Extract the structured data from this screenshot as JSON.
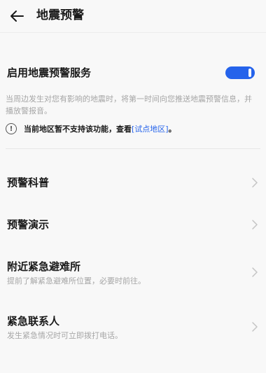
{
  "header": {
    "title": "地震预警",
    "back_icon": "arrow-left-icon"
  },
  "service": {
    "label": "启用地震预警服务",
    "enabled": true,
    "accent_color": "#2563eb"
  },
  "description": "当周边发生对您有影响的地震时，将第一时间向您推送地震预警信息，并播放警报音。",
  "notice": {
    "icon": "info-icon",
    "icon_glyph": "!",
    "text": "当前地区暂不支持该功能，查看",
    "link_text": "[试点地区]",
    "end": "。"
  },
  "menu": [
    {
      "title": "预警科普",
      "subtitle": ""
    },
    {
      "title": "预警演示",
      "subtitle": ""
    },
    {
      "title": "附近紧急避难所",
      "subtitle": "提前了解紧急避难所位置，必要时前往。"
    },
    {
      "title": "紧急联系人",
      "subtitle": "发生紧急情况时可立即拨打电话。"
    }
  ]
}
